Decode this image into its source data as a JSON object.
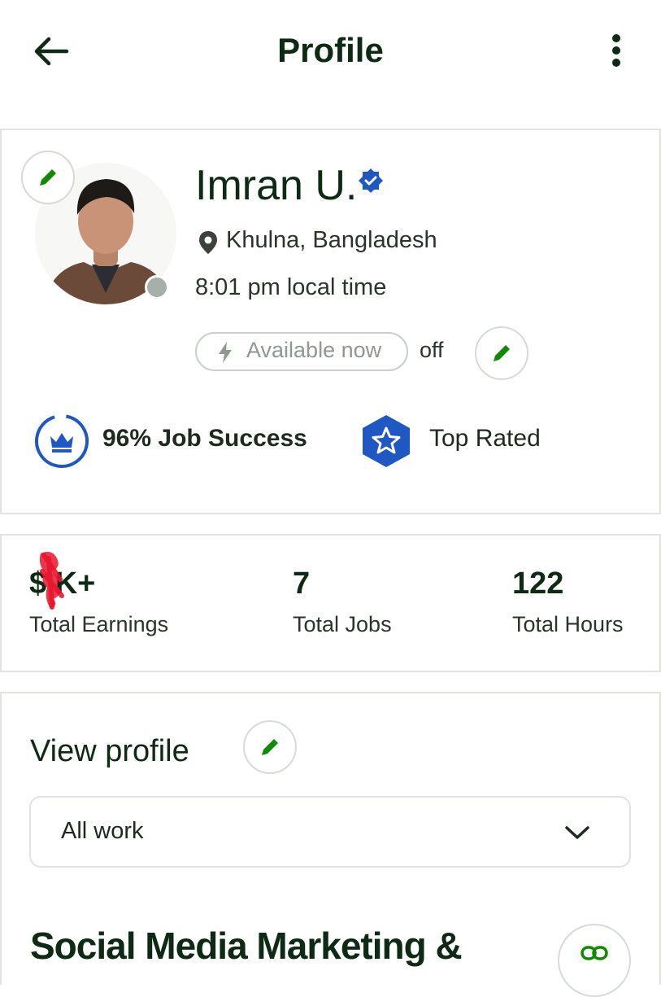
{
  "header": {
    "title": "Profile",
    "back_icon": "arrow-left-icon",
    "more_icon": "more-vertical-icon"
  },
  "profile": {
    "name": "Imran U.",
    "verified_icon": "verified-badge-icon",
    "location": "Khulna, Bangladesh",
    "local_time": "8:01 pm local time",
    "availability_label": "Available now",
    "availability_state": "off",
    "status_color": "#a8aea8"
  },
  "badges": {
    "job_success": "96% Job Success",
    "top_rated": "Top Rated"
  },
  "stats": [
    {
      "value": "$  K+",
      "label": "Total Earnings"
    },
    {
      "value": "7",
      "label": "Total Jobs"
    },
    {
      "value": "122",
      "label": "Total Hours"
    }
  ],
  "view_profile": {
    "title": "View profile",
    "selected": "All work"
  },
  "specialty": {
    "title": "Social Media Marketing &"
  },
  "colors": {
    "accent_green": "#108a00",
    "brand_blue": "#1f57c3",
    "dark_text": "#0f2a14",
    "redaction_red": "#e8152e"
  }
}
